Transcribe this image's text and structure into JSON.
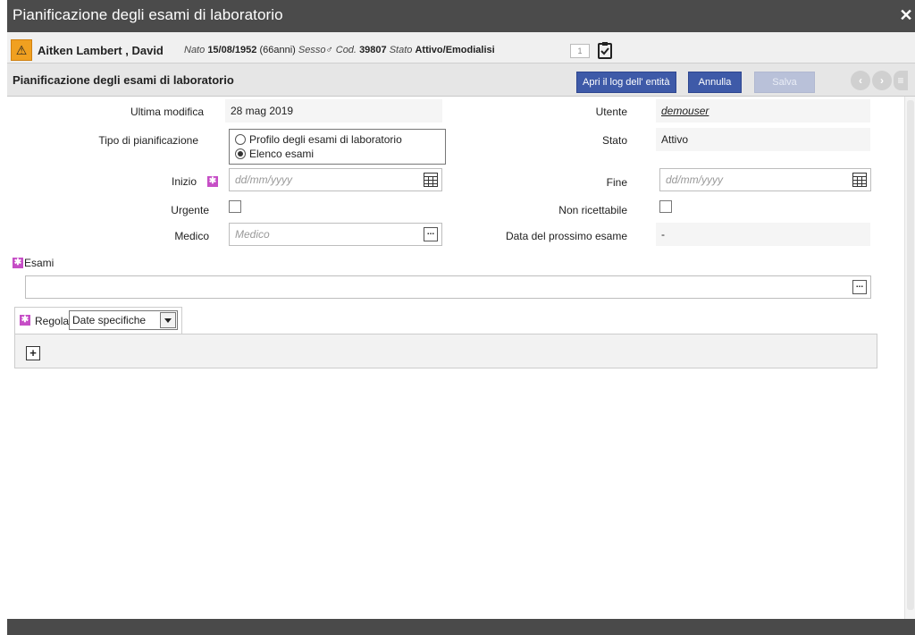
{
  "window": {
    "title": "Pianificazione degli esami di laboratorio",
    "close_icon": "close-icon"
  },
  "patient": {
    "warning_icon": "warning-icon",
    "name": "Aitken Lambert , David",
    "born_label": "Nato",
    "born_value": "15/08/1952",
    "age": "(66anni)",
    "sex_label": "Sesso",
    "code_label": "Cod.",
    "code_value": "39807",
    "status_label": "Stato",
    "status_value": "Attivo/Emodialisi",
    "badge": "1"
  },
  "section": {
    "title": "Pianificazione degli esami di laboratorio",
    "log_button": "Apri il log dell' entità",
    "cancel_button": "Annulla",
    "save_button": "Salva"
  },
  "form": {
    "last_modified_label": "Ultima modifica",
    "last_modified_value": "28 mag 2019",
    "user_label": "Utente",
    "user_value": "demouser",
    "plan_type_label": "Tipo di pianificazione",
    "plan_type_options": [
      "Profilo degli esami di laboratorio",
      "Elenco esami"
    ],
    "state_label": "Stato",
    "state_value": "Attivo",
    "start_label": "Inizio",
    "start_placeholder": "dd/mm/yyyy",
    "end_label": "Fine",
    "end_placeholder": "dd/mm/yyyy",
    "urgent_label": "Urgente",
    "non_refillable_label": "Non ricettabile",
    "doctor_label": "Medico",
    "doctor_placeholder": "Medico",
    "next_exam_label": "Data del prossimo esame",
    "next_exam_value": "-",
    "exams_label": "Esami",
    "rule_label": "Regola",
    "rule_value": "Date specifiche"
  },
  "colors": {
    "primary_button": "#3e5aa8",
    "required_marker": "#c64ec6",
    "warning": "#f0a020",
    "titlebar": "#4b4b4b"
  }
}
